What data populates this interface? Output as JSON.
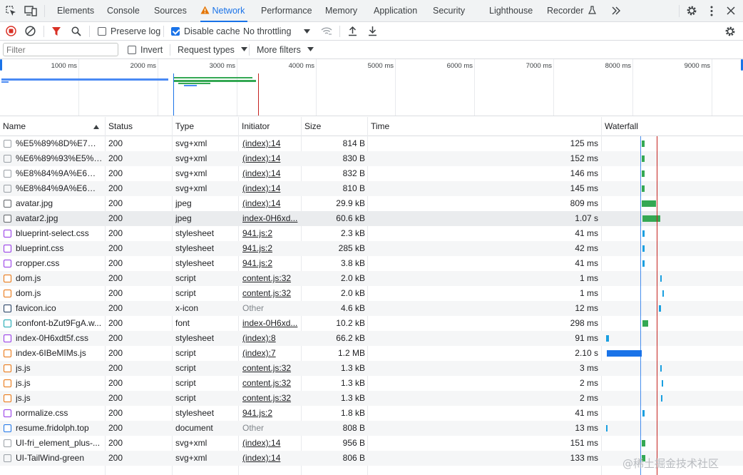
{
  "tabs": [
    "Elements",
    "Console",
    "Sources",
    "Network",
    "Performance",
    "Memory",
    "Application",
    "Security",
    "Lighthouse",
    "Recorder"
  ],
  "toolbar": {
    "preserve_log": "Preserve log",
    "disable_cache": "Disable cache",
    "throttling": "No throttling"
  },
  "filterbar": {
    "filter_placeholder": "Filter",
    "invert": "Invert",
    "request_types": "Request types",
    "more_filters": "More filters"
  },
  "overview": {
    "ticks": [
      "1000 ms",
      "2000 ms",
      "3000 ms",
      "4000 ms",
      "5000 ms",
      "6000 ms",
      "7000 ms",
      "8000 ms",
      "9000 ms"
    ]
  },
  "columns": {
    "name": "Name",
    "status": "Status",
    "type": "Type",
    "initiator": "Initiator",
    "size": "Size",
    "time": "Time",
    "waterfall": "Waterfall"
  },
  "rows": [
    {
      "name": "%E5%89%8D%E7%A...",
      "status": "200",
      "type": "svg+xml",
      "initiator": "(index):14",
      "size": "814 B",
      "time": "125 ms",
      "icon": "svg-file-icon"
    },
    {
      "name": "%E6%89%93%E5%8...",
      "status": "200",
      "type": "svg+xml",
      "initiator": "(index):14",
      "size": "830 B",
      "time": "152 ms",
      "icon": "svg-file-icon"
    },
    {
      "name": "%E8%84%9A%E6%8...",
      "status": "200",
      "type": "svg+xml",
      "initiator": "(index):14",
      "size": "832 B",
      "time": "146 ms",
      "icon": "svg-file-icon"
    },
    {
      "name": "%E8%84%9A%E6%9...",
      "status": "200",
      "type": "svg+xml",
      "initiator": "(index):14",
      "size": "810 B",
      "time": "145 ms",
      "icon": "svg-file-icon"
    },
    {
      "name": "avatar.jpg",
      "status": "200",
      "type": "jpeg",
      "initiator": "(index):14",
      "size": "29.9 kB",
      "time": "809 ms",
      "icon": "image-file-icon"
    },
    {
      "name": "avatar2.jpg",
      "status": "200",
      "type": "jpeg",
      "initiator": "index-0H6xd...",
      "size": "60.6 kB",
      "time": "1.07 s",
      "icon": "image-file-icon"
    },
    {
      "name": "blueprint-select.css",
      "status": "200",
      "type": "stylesheet",
      "initiator": "941.js:2",
      "size": "2.3 kB",
      "time": "41 ms",
      "icon": "css-file-icon"
    },
    {
      "name": "blueprint.css",
      "status": "200",
      "type": "stylesheet",
      "initiator": "941.js:2",
      "size": "285 kB",
      "time": "42 ms",
      "icon": "css-file-icon"
    },
    {
      "name": "cropper.css",
      "status": "200",
      "type": "stylesheet",
      "initiator": "941.js:2",
      "size": "3.8 kB",
      "time": "41 ms",
      "icon": "css-file-icon"
    },
    {
      "name": "dom.js",
      "status": "200",
      "type": "script",
      "initiator": "content.js:32",
      "size": "2.0 kB",
      "time": "1 ms",
      "icon": "script-file-icon"
    },
    {
      "name": "dom.js",
      "status": "200",
      "type": "script",
      "initiator": "content.js:32",
      "size": "2.0 kB",
      "time": "1 ms",
      "icon": "script-file-icon"
    },
    {
      "name": "favicon.ico",
      "status": "200",
      "type": "x-icon",
      "initiator": "Other",
      "size": "4.6 kB",
      "time": "12 ms",
      "icon": "favicon-file-icon"
    },
    {
      "name": "iconfont-bZut9FgA.w...",
      "status": "200",
      "type": "font",
      "initiator": "index-0H6xd...",
      "size": "10.2 kB",
      "time": "298 ms",
      "icon": "font-file-icon"
    },
    {
      "name": "index-0H6xdt5f.css",
      "status": "200",
      "type": "stylesheet",
      "initiator": "(index):8",
      "size": "66.2 kB",
      "time": "91 ms",
      "icon": "css-file-icon"
    },
    {
      "name": "index-6IBeMIMs.js",
      "status": "200",
      "type": "script",
      "initiator": "(index):7",
      "size": "1.2 MB",
      "time": "2.10 s",
      "icon": "script-file-icon"
    },
    {
      "name": "js.js",
      "status": "200",
      "type": "script",
      "initiator": "content.js:32",
      "size": "1.3 kB",
      "time": "3 ms",
      "icon": "script-file-icon"
    },
    {
      "name": "js.js",
      "status": "200",
      "type": "script",
      "initiator": "content.js:32",
      "size": "1.3 kB",
      "time": "2 ms",
      "icon": "script-file-icon"
    },
    {
      "name": "js.js",
      "status": "200",
      "type": "script",
      "initiator": "content.js:32",
      "size": "1.3 kB",
      "time": "2 ms",
      "icon": "script-file-icon"
    },
    {
      "name": "normalize.css",
      "status": "200",
      "type": "stylesheet",
      "initiator": "941.js:2",
      "size": "1.8 kB",
      "time": "41 ms",
      "icon": "css-file-icon"
    },
    {
      "name": "resume.fridolph.top",
      "status": "200",
      "type": "document",
      "initiator": "Other",
      "size": "808 B",
      "time": "13 ms",
      "icon": "document-file-icon"
    },
    {
      "name": "UI-fri_element_plus-...",
      "status": "200",
      "type": "svg+xml",
      "initiator": "(index):14",
      "size": "956 B",
      "time": "151 ms",
      "icon": "svg-file-icon"
    },
    {
      "name": "UI-TailWind-green",
      "status": "200",
      "type": "svg+xml",
      "initiator": "(index):14",
      "size": "806 B",
      "time": "133 ms",
      "icon": "svg-file-icon"
    }
  ],
  "watermark": "@稀土掘金技术社区",
  "colors": {
    "accent": "#1a73e8",
    "record": "#d93025",
    "css": "#9334e6",
    "script": "#e8710a",
    "waterfall_green": "#34a853",
    "waterfall_blue": "#1a73e8",
    "load_line": "#c5221f"
  }
}
